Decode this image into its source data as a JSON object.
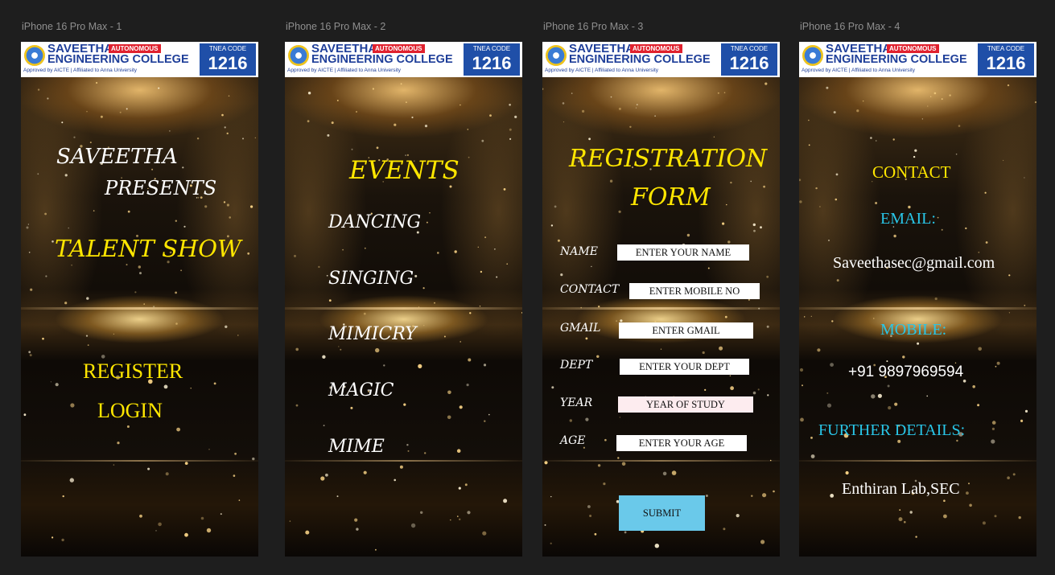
{
  "frames": [
    {
      "label": "iPhone 16 Pro Max - 1"
    },
    {
      "label": "iPhone 16 Pro Max - 2"
    },
    {
      "label": "iPhone 16 Pro Max - 3"
    },
    {
      "label": "iPhone 16 Pro Max - 4"
    }
  ],
  "banner": {
    "name_line1": "SAVEETHA",
    "name_line2": "ENGINEERING COLLEGE",
    "autonomous": "AUTONOMOUS",
    "approved": "Approved by AICTE  |  Affiliated to Anna University",
    "tnea_label": "TNEA CODE",
    "tnea_code": "1216"
  },
  "screen1": {
    "line1": "SAVEETHA",
    "line2": "PRESENTS",
    "title": "TALENT SHOW",
    "register": "REGISTER",
    "login": "LOGIN"
  },
  "screen2": {
    "heading": "EVENTS",
    "events": [
      "DANCING",
      "SINGING",
      "MIMICRY",
      "MAGIC",
      "MIME"
    ]
  },
  "screen3": {
    "heading_line1": "REGISTRATION",
    "heading_line2": "FORM",
    "fields": [
      {
        "label": "NAME",
        "placeholder": "ENTER YOUR NAME"
      },
      {
        "label": "CONTACT",
        "placeholder": "ENTER MOBILE NO"
      },
      {
        "label": "GMAIL",
        "placeholder": "ENTER GMAIL"
      },
      {
        "label": "DEPT",
        "placeholder": "ENTER YOUR DEPT"
      },
      {
        "label": "YEAR",
        "placeholder": "YEAR OF STUDY"
      },
      {
        "label": "AGE",
        "placeholder": "ENTER YOUR AGE"
      }
    ],
    "submit": "SUBMIT"
  },
  "screen4": {
    "heading": "CONTACT",
    "email_label": "EMAIL:",
    "email": "Saveethasec@gmail.com",
    "mobile_label": "MOBILE:",
    "mobile": "+91 9897969594",
    "further_label": "FURTHER DETAILS:",
    "further": "Enthiran Lab,SEC"
  },
  "colors": {
    "canvas": "#1e1e1e",
    "yellow": "#ffe600",
    "cyan": "#29c6e8",
    "white": "#ffffff",
    "submit": "#6ac9ea"
  }
}
